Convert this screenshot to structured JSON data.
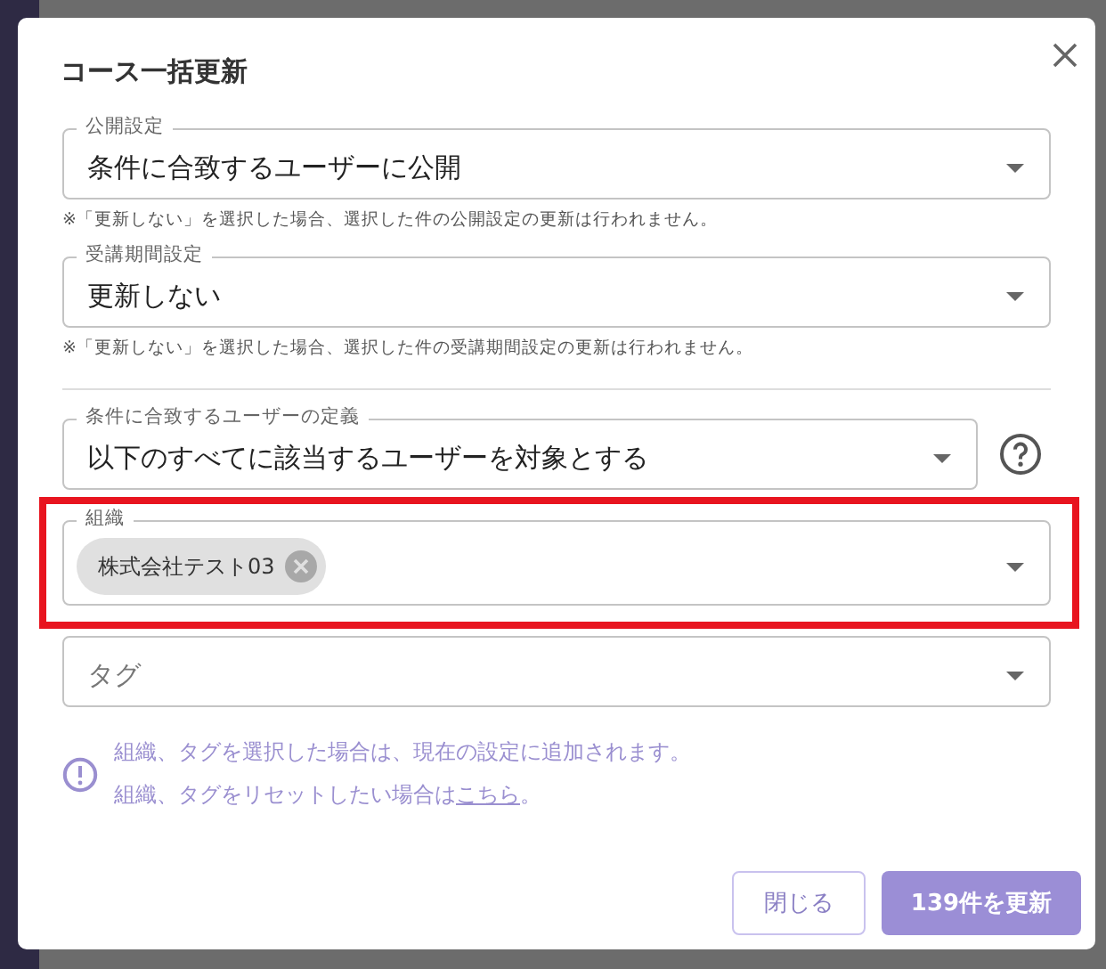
{
  "dialog": {
    "title": "コース一括更新",
    "fields": [
      {
        "kind": "select",
        "label": "公開設定",
        "value": "条件に合致するユーザーに公開",
        "helper": "※「更新しない」を選択した場合、選択した件の公開設定の更新は行われません。",
        "highlighted": false
      },
      {
        "kind": "select",
        "label": "受講期間設定",
        "value": "更新しない",
        "helper": "※「更新しない」を選択した場合、選択した件の受講期間設定の更新は行われません。",
        "highlighted": false,
        "divider_after": true
      },
      {
        "kind": "select",
        "label": "条件に合致するユーザーの定義",
        "value": "以下のすべてに該当するユーザーを対象とする",
        "help": true,
        "highlighted": false
      },
      {
        "kind": "chips",
        "label": "組織",
        "chips": [
          "株式会社テスト03"
        ],
        "highlighted": true
      },
      {
        "kind": "select",
        "placeholder": "タグ",
        "highlighted": false
      }
    ],
    "info": {
      "line_1": "組織、タグを選択した場合は、現在の設定に追加されます。",
      "line_2": "組織、タグをリセットしたい場合は",
      "link": "こちら",
      "line_2_end": "。"
    },
    "buttons": [
      {
        "label": "閉じる",
        "kind": "secondary"
      },
      {
        "label": "139件を更新",
        "kind": "primary"
      }
    ]
  }
}
